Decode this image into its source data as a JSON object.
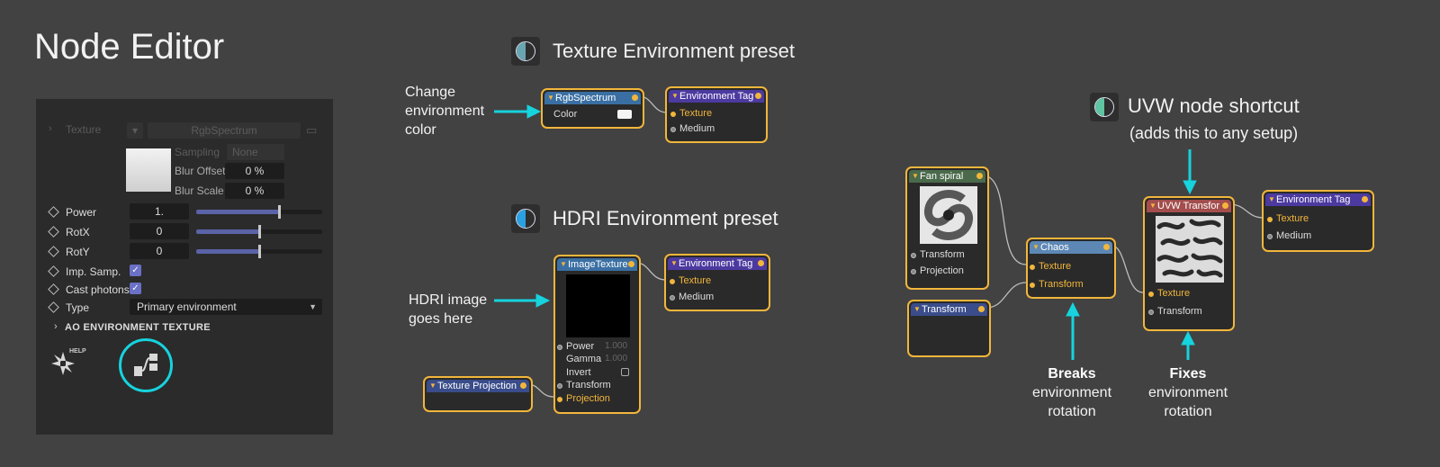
{
  "page": {
    "title": "Node Editor"
  },
  "panel": {
    "texture_label": "Texture",
    "texture_value": "RgbSpectrum",
    "sampling_label": "Sampling",
    "sampling_value": "None",
    "blur_offset_label": "Blur Offset",
    "blur_offset_value": "0 %",
    "blur_scale_label": "Blur Scale",
    "blur_scale_value": "0 %",
    "rows": [
      {
        "label": "Power",
        "value": "1.",
        "slider": 0.66
      },
      {
        "label": "RotX",
        "value": "0",
        "slider": 0.5
      },
      {
        "label": "RotY",
        "value": "0",
        "slider": 0.5
      },
      {
        "label": "Imp. Samp.",
        "checked": true
      },
      {
        "label": "Cast photons",
        "checked": true
      },
      {
        "label": "Type",
        "dropdown": "Primary environment"
      }
    ],
    "ao_header": "AO ENVIRONMENT TEXTURE",
    "help_text": "HELP",
    "icons": [
      "octane-logo-icon",
      "node-editor-icon"
    ],
    "highlight_color": "#16d3de"
  },
  "sections": {
    "texture_preset": "Texture Environment preset",
    "hdri_preset": "HDRI Environment preset",
    "uvw_shortcut": "UVW node shortcut",
    "uvw_sub": "(adds this to any setup)"
  },
  "annotations": {
    "change_env": [
      "Change",
      "environment",
      "color"
    ],
    "hdri_goes": [
      "HDRI image",
      "goes here"
    ],
    "breaks": {
      "bold": "Breaks",
      "lines": [
        "environment",
        "rotation"
      ]
    },
    "fixes": {
      "bold": "Fixes",
      "lines": [
        "environment",
        "rotation"
      ]
    }
  },
  "nodes": {
    "rgb": {
      "title": "RgbSpectrum",
      "pin": "Color"
    },
    "env1": {
      "title": "Environment Tag",
      "pins": [
        "Texture",
        "Medium"
      ]
    },
    "image": {
      "title": "ImageTexture",
      "pins": [
        "Power",
        "Gamma",
        "Invert",
        "Transform",
        "Projection"
      ],
      "power": "1.000",
      "gamma": "1.000"
    },
    "env2": {
      "title": "Environment Tag",
      "pins": [
        "Texture",
        "Medium"
      ]
    },
    "texproj": {
      "title": "Texture Projection"
    },
    "fan": {
      "title": "Fan spiral",
      "pins": [
        "Transform",
        "Projection"
      ]
    },
    "transform": {
      "title": "Transform"
    },
    "chaos": {
      "title": "Chaos",
      "pins": [
        "Texture",
        "Transform"
      ]
    },
    "uvw": {
      "title": "UVW Transfor",
      "pins": [
        "Texture",
        "Transform"
      ]
    },
    "env3": {
      "title": "Environment Tag",
      "pins": [
        "Texture",
        "Medium"
      ]
    }
  },
  "colors": {
    "node_border": "#f2b63b",
    "arrow": "#16d3de",
    "background": "#424242"
  }
}
